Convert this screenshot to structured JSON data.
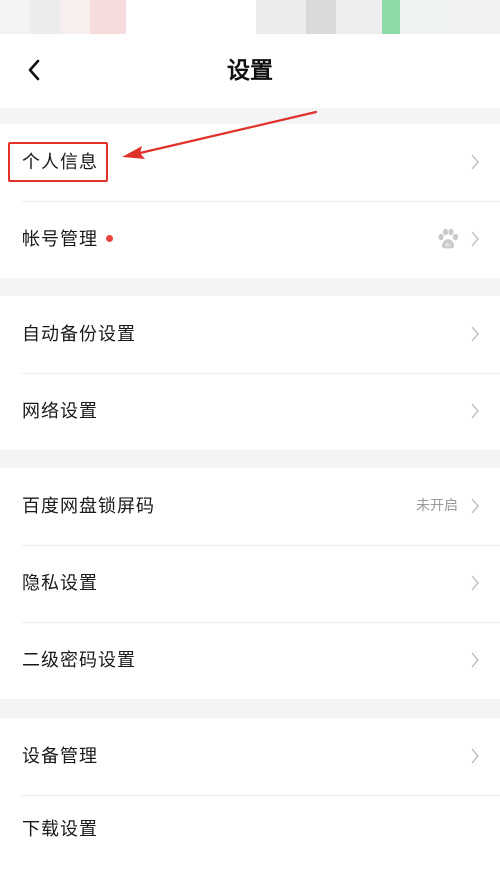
{
  "nav": {
    "title": "设置"
  },
  "groups": [
    {
      "items": [
        {
          "label": "个人信息"
        },
        {
          "label": "帐号管理"
        }
      ]
    },
    {
      "items": [
        {
          "label": "自动备份设置"
        },
        {
          "label": "网络设置"
        }
      ]
    },
    {
      "items": [
        {
          "label": "百度网盘锁屏码",
          "value": "未开启"
        },
        {
          "label": "隐私设置"
        },
        {
          "label": "二级密码设置"
        }
      ]
    },
    {
      "items": [
        {
          "label": "设备管理"
        },
        {
          "label": "下载设置"
        }
      ]
    }
  ],
  "colors": {
    "accent_red": "#e0322b",
    "dot_red": "#e8453c",
    "chevron": "#c4c4c4",
    "value_gray": "#9a9a9a"
  },
  "icons": {
    "back": "chevron-left-icon",
    "account": "baidu-paw-icon",
    "row_arrow": "chevron-right-icon"
  }
}
